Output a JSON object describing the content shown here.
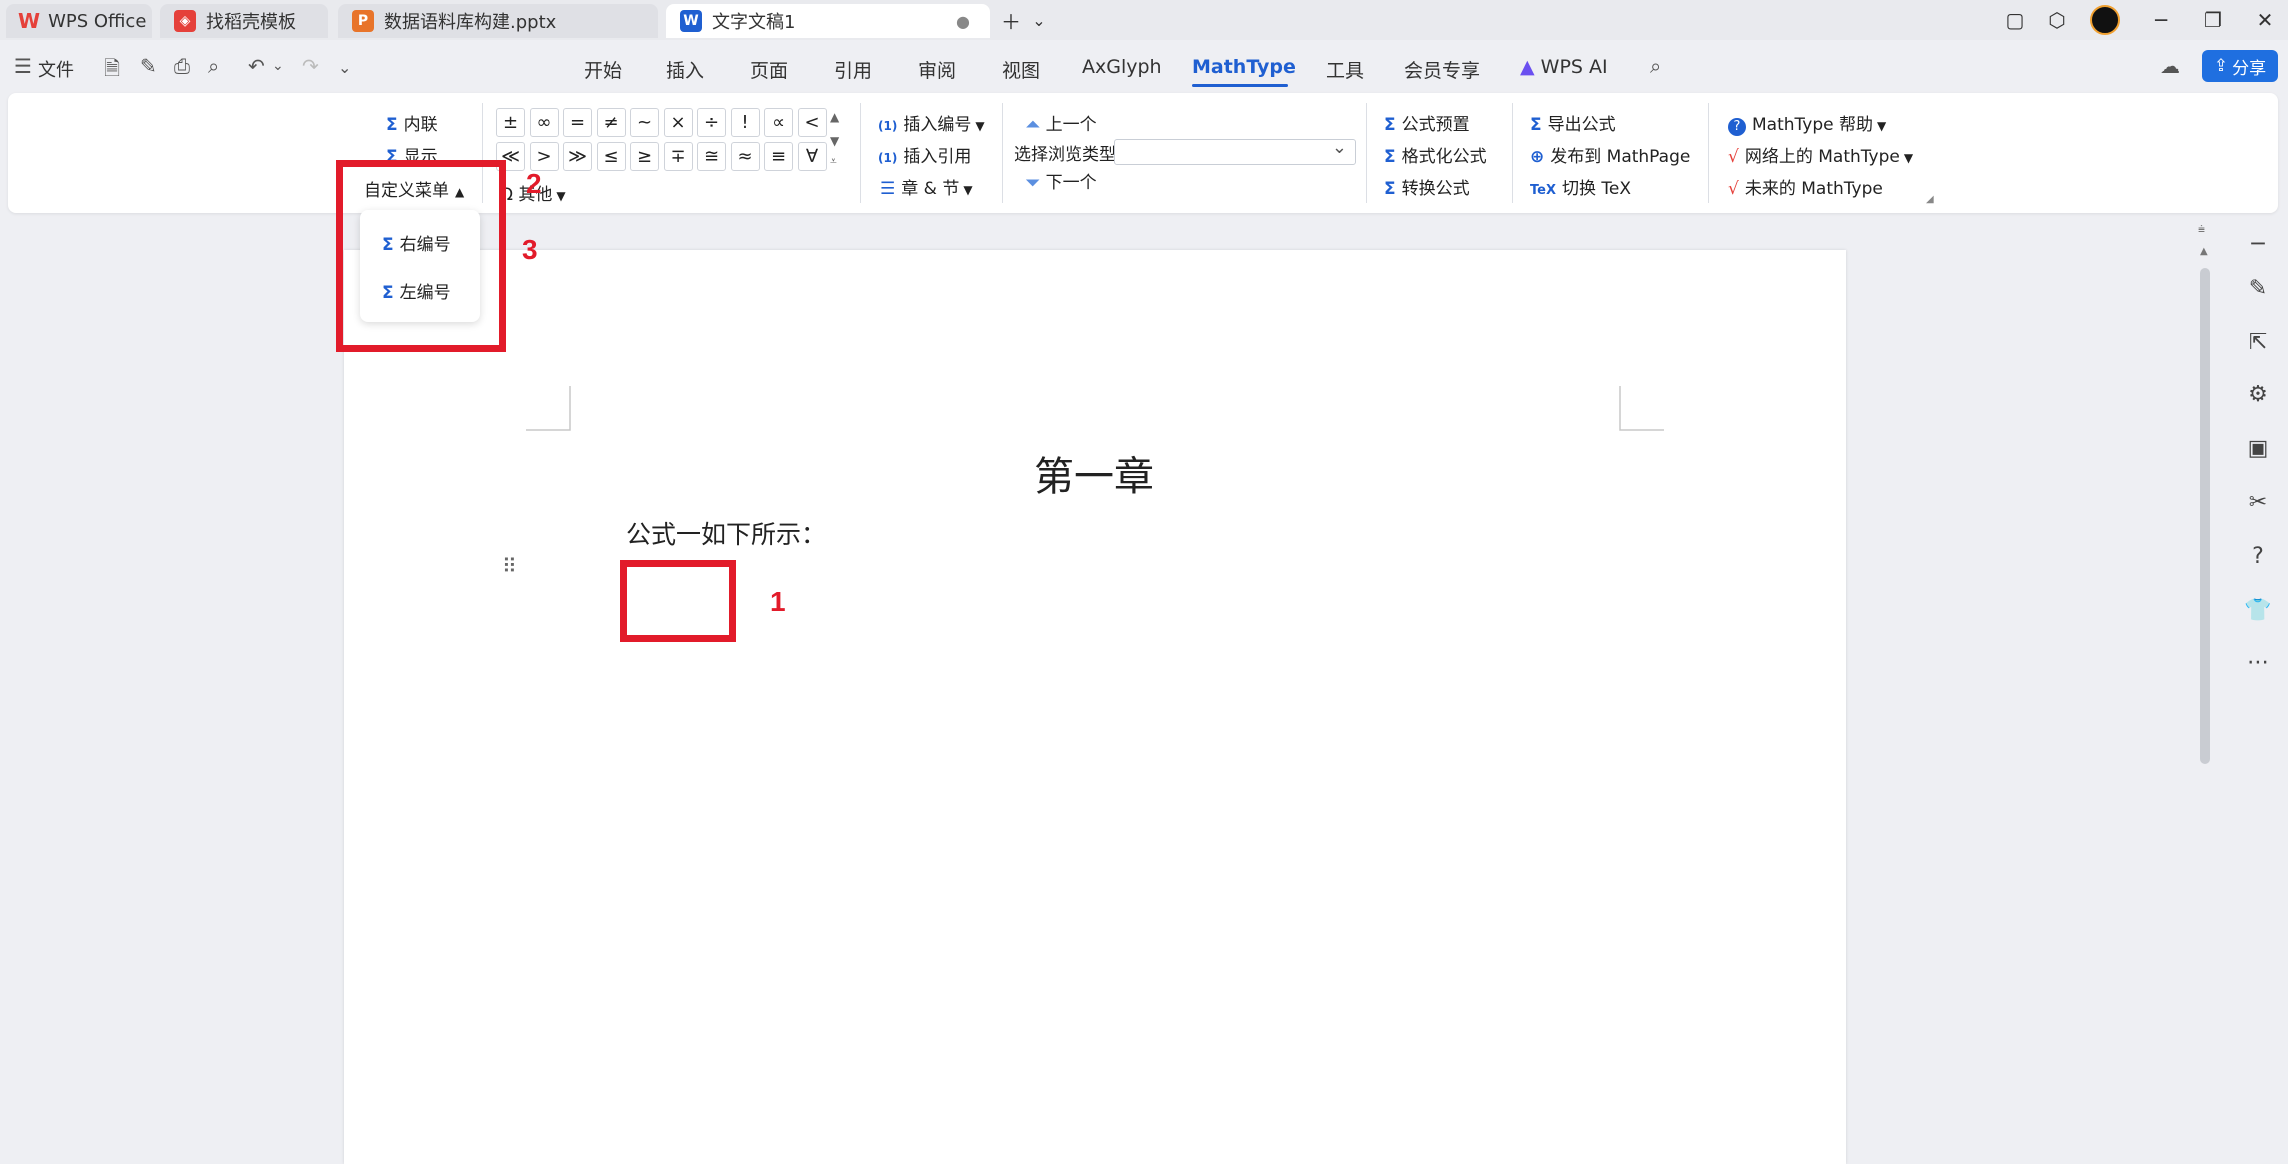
{
  "tabs": [
    {
      "label": "WPS Office",
      "icon": "wps-logo-icon",
      "color": "#e5403a"
    },
    {
      "label": "找稻壳模板",
      "icon": "docer-icon",
      "color": "#e5403a"
    },
    {
      "label": "数据语料库构建.pptx",
      "icon": "pptx-icon",
      "letter": "P",
      "color": "#e8742a"
    },
    {
      "label": "文字文稿1",
      "icon": "writer-icon",
      "letter": "W",
      "color": "#1f5fd1"
    }
  ],
  "menubar": {
    "file": "文件",
    "items": [
      "开始",
      "插入",
      "页面",
      "引用",
      "审阅",
      "视图",
      "AxGlyph",
      "MathType",
      "工具",
      "会员专享"
    ],
    "active": "MathType",
    "wps_ai": "WPS AI",
    "share": "分享"
  },
  "ribbon": {
    "inline": "内联",
    "display": "显示",
    "custom_menu": "自定义菜单",
    "symbols_row1": [
      "±",
      "∞",
      "=",
      "≠",
      "~",
      "×",
      "÷",
      "!",
      "∝",
      "<"
    ],
    "symbols_row2": [
      "≪",
      ">",
      "≫",
      "≤",
      "≥",
      "∓",
      "≅",
      "≈",
      "≡",
      "∀"
    ],
    "other": "其他",
    "insert_number": "插入编号",
    "insert_ref": "插入引用",
    "chapter_section": "章 & 节",
    "prev": "上一个",
    "browse_type": "选择浏览类型",
    "next": "下一个",
    "formula_preset": "公式预置",
    "format_formula": "格式化公式",
    "convert_formula": "转换公式",
    "export_formula": "导出公式",
    "publish_mathpage": "发布到 MathPage",
    "toggle_tex": "切换 TeX",
    "mathtype_help": "MathType 帮助",
    "mathtype_online": "网络上的 MathType",
    "future_mathtype": "未来的 MathType"
  },
  "dropdown": {
    "right_number": "右编号",
    "left_number": "左编号"
  },
  "annotations": [
    "1",
    "2",
    "3"
  ],
  "document": {
    "title": "第一章",
    "line1": "公式一如下所示："
  },
  "accent_color": "#1f5fd1",
  "annotation_color": "#e21b2a"
}
